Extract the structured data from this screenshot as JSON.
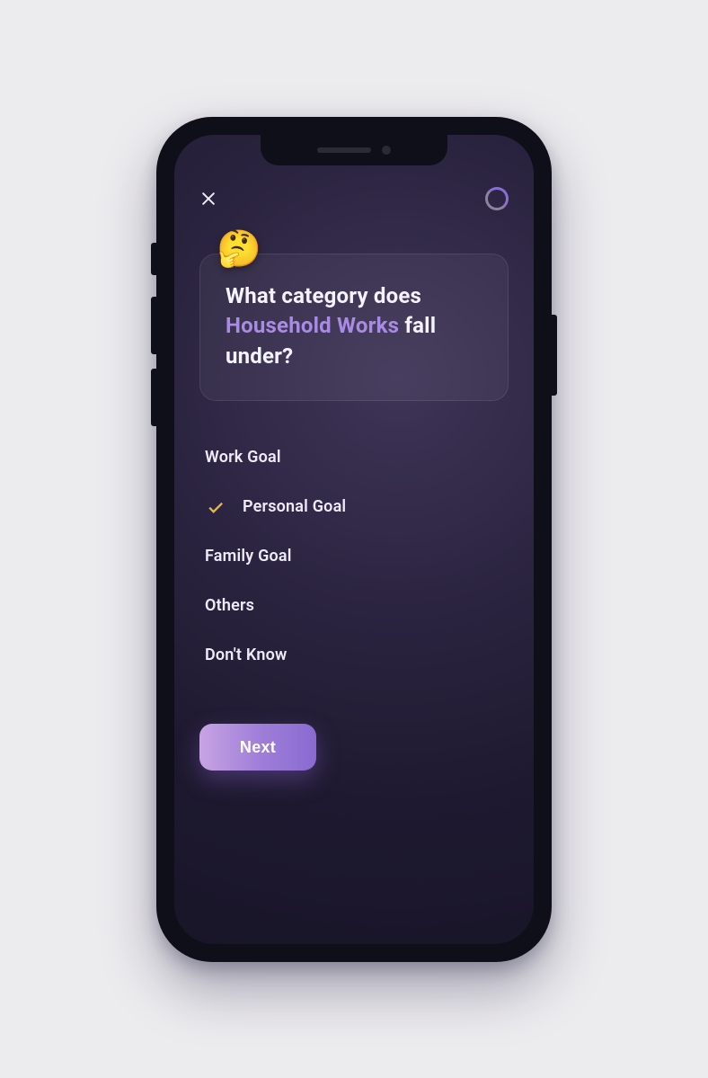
{
  "header": {
    "close": "close",
    "spinner": "loading-indicator"
  },
  "question": {
    "emoji": "🤔",
    "prefix": "What category does ",
    "highlight": "Household Works",
    "suffix": " fall under?"
  },
  "options": [
    {
      "label": "Work Goal",
      "selected": false
    },
    {
      "label": "Personal Goal",
      "selected": true
    },
    {
      "label": "Family Goal",
      "selected": false
    },
    {
      "label": "Others",
      "selected": false
    },
    {
      "label": "Don't Know",
      "selected": false
    }
  ],
  "actions": {
    "next": "Next"
  },
  "colors": {
    "accent": "#a98be6",
    "check": "#e6b642"
  }
}
